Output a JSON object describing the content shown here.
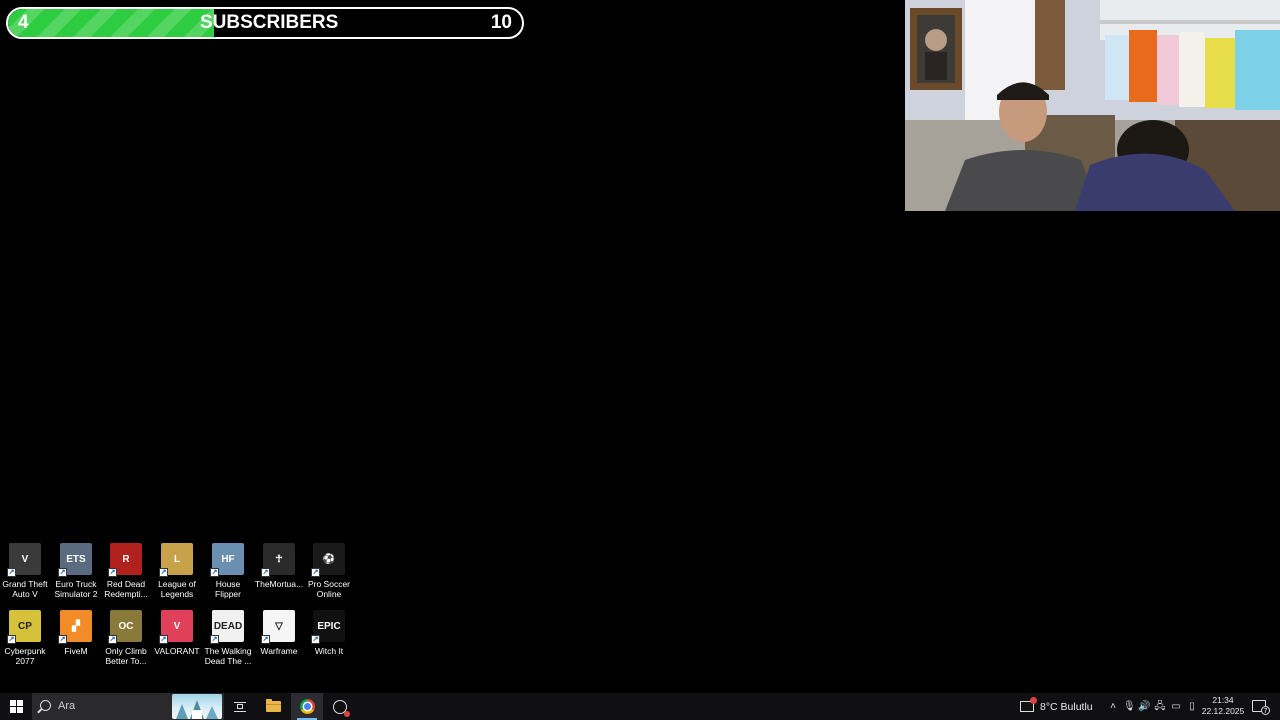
{
  "goal": {
    "current": "4",
    "title": "SUBSCRIBERS",
    "target": "10",
    "progress_fraction": 0.4,
    "fill_color": "#2ecc40"
  },
  "desktop_icons": [
    {
      "label": "Grand Theft\nAuto V",
      "icon": "gta5-icon",
      "color": "#3a3a3a"
    },
    {
      "label": "Euro Truck\nSimulator 2",
      "icon": "ets2-icon",
      "color": "#5a6a80"
    },
    {
      "label": "Red Dead\nRedempti...",
      "icon": "rdr-icon",
      "color": "#b0201c"
    },
    {
      "label": "League of\nLegends",
      "icon": "lol-icon",
      "color": "#c8a24a"
    },
    {
      "label": "House\nFlipper",
      "icon": "house-flipper-icon",
      "color": "#6a8fb0"
    },
    {
      "label": "TheMortua...",
      "icon": "mortuary-icon",
      "color": "#2a2a2a"
    },
    {
      "label": "Pro Soccer\nOnline",
      "icon": "pro-soccer-icon",
      "color": "#1a1a1a"
    },
    {
      "label": "Cyberpunk\n2077",
      "icon": "cyberpunk-icon",
      "color": "#d6c23a"
    },
    {
      "label": "FiveM",
      "icon": "fivem-icon",
      "color": "#f28c28"
    },
    {
      "label": "Only Climb\nBetter To...",
      "icon": "only-climb-icon",
      "color": "#8a7a3a"
    },
    {
      "label": "VALORANT",
      "icon": "valorant-icon",
      "color": "#e0405a"
    },
    {
      "label": "The Walking\nDead The ...",
      "icon": "walking-dead-icon",
      "color": "#f0f0f0"
    },
    {
      "label": "Warframe",
      "icon": "warframe-icon",
      "color": "#f5f5f5"
    },
    {
      "label": "Witch It",
      "icon": "epic-games-icon",
      "color": "#111111"
    }
  ],
  "icon_glyphs": {
    "gta5-icon": "V",
    "ets2-icon": "ETS",
    "rdr-icon": "R",
    "lol-icon": "L",
    "house-flipper-icon": "HF",
    "mortuary-icon": "☥",
    "pro-soccer-icon": "⚽",
    "cyberpunk-icon": "CP",
    "fivem-icon": "▞",
    "only-climb-icon": "OC",
    "valorant-icon": "V",
    "walking-dead-icon": "DEAD",
    "warframe-icon": "▽",
    "epic-games-icon": "EPIC"
  },
  "taskbar": {
    "search_placeholder": "Ara",
    "weather": "8°C  Bulutlu",
    "time": "21:34",
    "date": "22.12.2025",
    "notification_count": "7"
  }
}
